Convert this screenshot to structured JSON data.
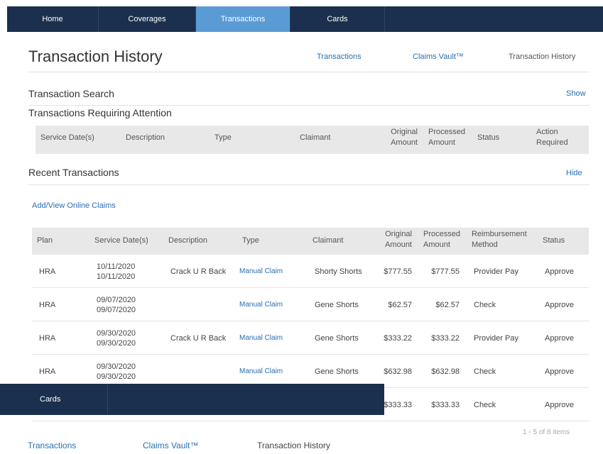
{
  "nav": {
    "tabs": [
      {
        "label": "Home"
      },
      {
        "label": "Coverages"
      },
      {
        "label": "Transactions"
      },
      {
        "label": "Cards"
      }
    ]
  },
  "header": {
    "title": "Transaction History",
    "links": {
      "transactions": "Transactions",
      "claims_vault": "Claims Vault™"
    },
    "current": "Transaction History"
  },
  "search": {
    "title": "Transaction Search",
    "toggle": "Show"
  },
  "attention": {
    "title": "Transactions Requiring Attention",
    "columns": {
      "service_dates": "Service Date(s)",
      "description": "Description",
      "type": "Type",
      "claimant": "Claimant",
      "original_1": "Original",
      "original_2": "Amount",
      "processed_1": "Processed",
      "processed_2": "Amount",
      "status": "Status",
      "action_1": "Action",
      "action_2": "Required"
    }
  },
  "recent": {
    "title": "Recent Transactions",
    "toggle": "Hide",
    "add_view": "Add/View Online Claims",
    "columns": {
      "plan": "Plan",
      "service_dates": "Service Date(s)",
      "description": "Description",
      "type": "Type",
      "claimant": "Claimant",
      "original_1": "Original",
      "original_2": "Amount",
      "processed_1": "Processed",
      "processed_2": "Amount",
      "method_1": "Reimbursement",
      "method_2": "Method",
      "status": "Status"
    },
    "rows": [
      {
        "plan": "HRA",
        "date1": "10/11/2020",
        "date2": "10/11/2020",
        "description": "Crack U R Back",
        "type": "Manual Claim",
        "claimant": "Shorty Shorts",
        "original": "$777.55",
        "processed": "$777.55",
        "method": "Provider Pay",
        "status": "Approve"
      },
      {
        "plan": "HRA",
        "date1": "09/07/2020",
        "date2": "09/07/2020",
        "description": "",
        "type": "Manual Claim",
        "claimant": "Gene Shorts",
        "original": "$62.57",
        "processed": "$62.57",
        "method": "Check",
        "status": "Approve"
      },
      {
        "plan": "HRA",
        "date1": "09/30/2020",
        "date2": "09/30/2020",
        "description": "Crack U R Back",
        "type": "Manual Claim",
        "claimant": "Gene Shorts",
        "original": "$333.22",
        "processed": "$333.22",
        "method": "Provider Pay",
        "status": "Approve"
      },
      {
        "plan": "HRA",
        "date1": "09/30/2020",
        "date2": "09/30/2020",
        "description": "",
        "type": "Manual Claim",
        "claimant": "Gene Shorts",
        "original": "$632.98",
        "processed": "$632.98",
        "method": "Check",
        "status": "Approve"
      },
      {
        "plan": "",
        "date1": "",
        "date2": "",
        "description": "",
        "type": "",
        "claimant": "",
        "original": "$333.33",
        "processed": "$333.33",
        "method": "Check",
        "status": "Approve"
      }
    ],
    "pager": "1 - 5 of 8 items"
  },
  "overlay": {
    "cards_label": "Cards"
  },
  "footer": {
    "transactions": "Transactions",
    "claims_vault": "Claims Vault™",
    "current": "Transaction History"
  }
}
